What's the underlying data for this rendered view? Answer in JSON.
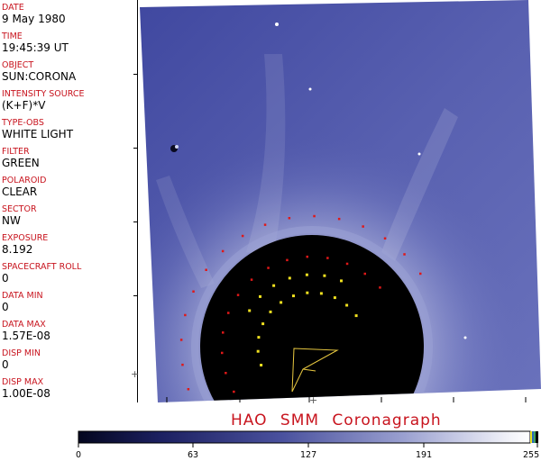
{
  "header_fields": [
    {
      "label": "DATE",
      "value": "9 May 1980"
    },
    {
      "label": "TIME",
      "value": "19:45:39 UT"
    },
    {
      "label": "OBJECT",
      "value": "SUN:CORONA"
    },
    {
      "label": "INTENSITY SOURCE",
      "value": "(K+F)*V"
    },
    {
      "label": "TYPE-OBS",
      "value": "WHITE LIGHT"
    },
    {
      "label": "FILTER",
      "value": "GREEN"
    },
    {
      "label": "POLAROID",
      "value": "CLEAR"
    },
    {
      "label": "SECTOR",
      "value": "NW"
    },
    {
      "label": "EXPOSURE",
      "value": "8.192"
    },
    {
      "label": "SPACECRAFT ROLL",
      "value": "0"
    },
    {
      "label": "DATA MIN",
      "value": "0"
    },
    {
      "label": "DATA MAX",
      "value": "1.57E-08"
    },
    {
      "label": "DISP MIN",
      "value": "0"
    },
    {
      "label": "DISP MAX",
      "value": "1.00E-08"
    }
  ],
  "instrument_title": "HAO  SMM Coronagraph",
  "colorbar": {
    "ticks": [
      "0",
      "63",
      "127",
      "191",
      "255"
    ],
    "colors": {
      "dark": "#03061e",
      "mid": "#4a519e",
      "light": "#e6e8f4"
    }
  },
  "colors": {
    "label_red": "#c8141e",
    "corona_blue": "#5058a8",
    "occulter": "#000000",
    "marker_red": "#e01818",
    "marker_yellow": "#f0e020"
  }
}
